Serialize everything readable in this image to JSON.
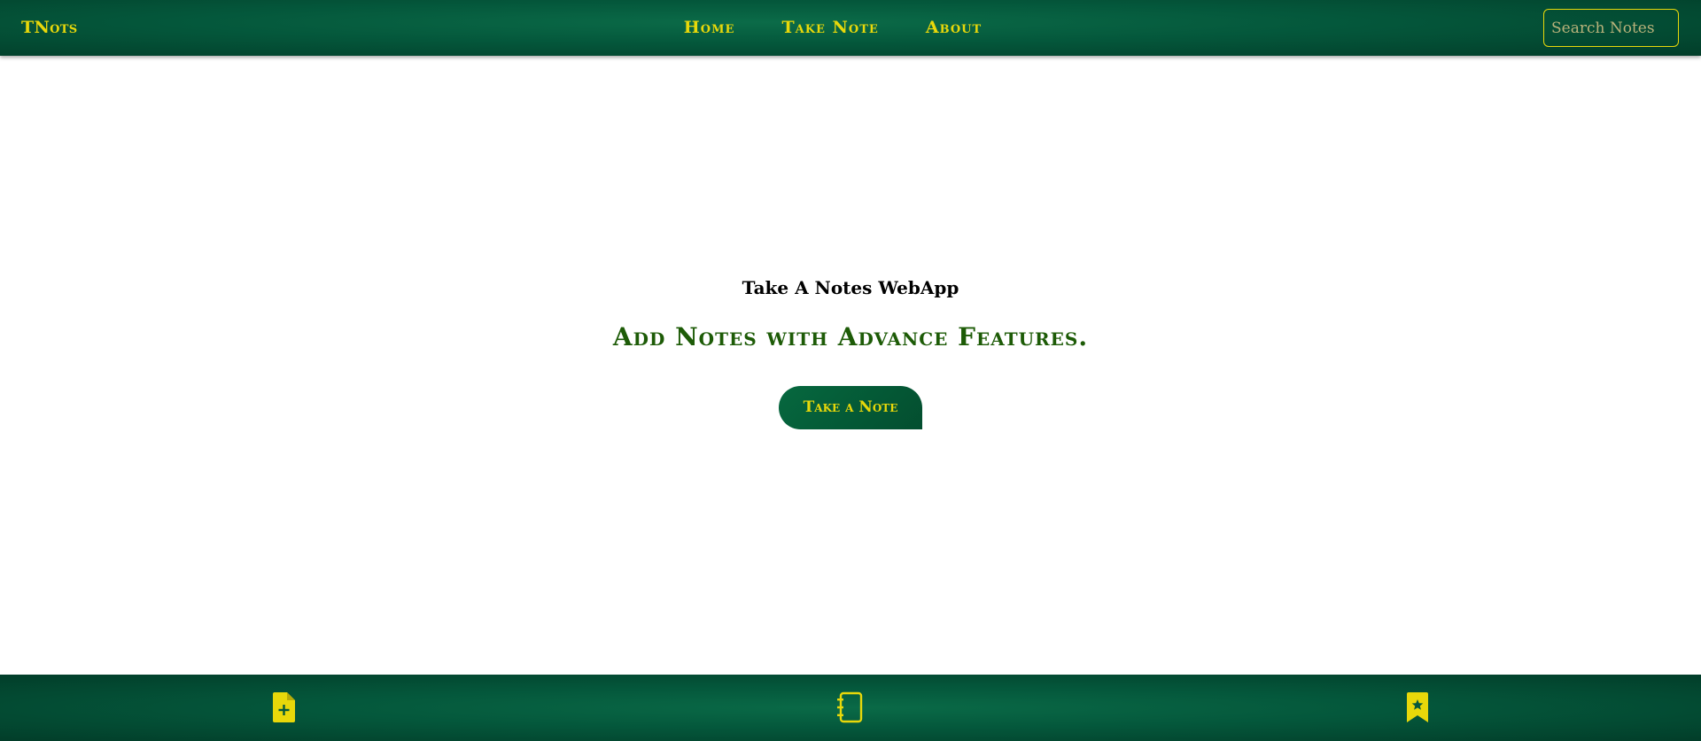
{
  "header": {
    "brand": "TNots",
    "nav": [
      {
        "label": "Home"
      },
      {
        "label": "Take Note"
      },
      {
        "label": "About"
      }
    ],
    "search": {
      "placeholder": "Search Notes",
      "value": ""
    }
  },
  "hero": {
    "subtitle": "Take A Notes WebApp",
    "title": "Add Notes with Advance Features.",
    "cta_label": "Take a Note"
  },
  "footer": {
    "icons": [
      "file-plus-icon",
      "notebook-icon",
      "bookmark-star-icon"
    ]
  },
  "colors": {
    "primary_green": "#04573b",
    "accent_yellow": "#e8d80a",
    "headline_green": "#1d5b07"
  }
}
